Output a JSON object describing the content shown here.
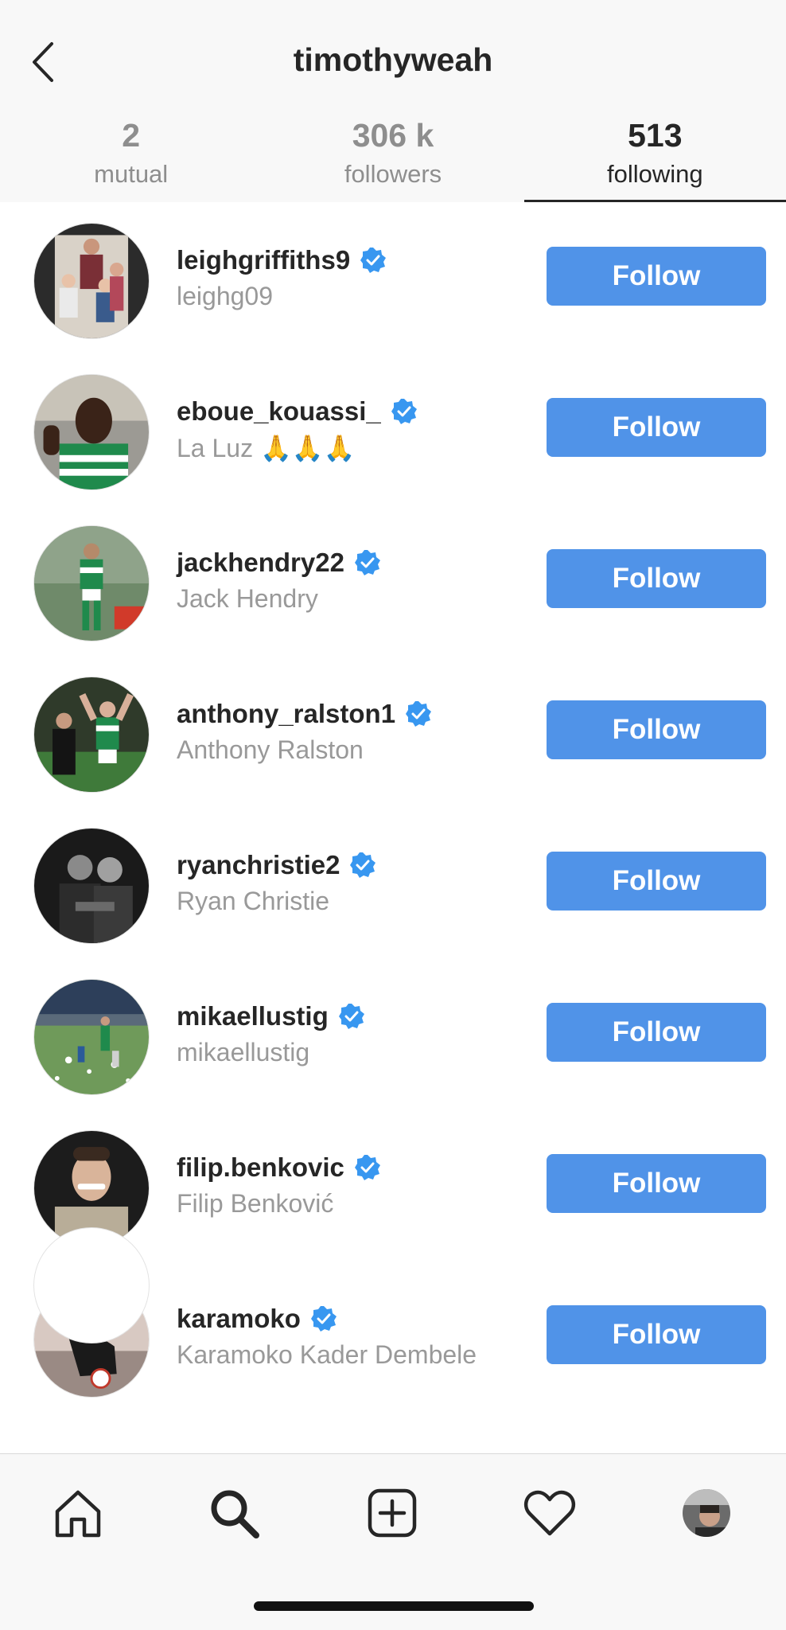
{
  "header": {
    "title": "timothyweah",
    "tabs": [
      {
        "count": "2",
        "label": "mutual",
        "active": false
      },
      {
        "count": "306 k",
        "label": "followers",
        "active": false
      },
      {
        "count": "513",
        "label": "following",
        "active": true
      }
    ]
  },
  "accounts": [
    {
      "username": "leighgriffiths9",
      "fullname": "leighg09",
      "button": "Follow"
    },
    {
      "username": "eboue_kouassi_",
      "fullname": "La Luz 🙏🙏🙏",
      "button": "Follow"
    },
    {
      "username": "jackhendry22",
      "fullname": "Jack Hendry",
      "button": "Follow"
    },
    {
      "username": "anthony_ralston1",
      "fullname": "Anthony Ralston",
      "button": "Follow"
    },
    {
      "username": "ryanchristie2",
      "fullname": "Ryan Christie",
      "button": "Follow"
    },
    {
      "username": "mikaellustig",
      "fullname": "mikaellustig",
      "button": "Follow"
    },
    {
      "username": "filip.benkovic",
      "fullname": "Filip Benković",
      "button": "Follow"
    },
    {
      "username": "karamoko",
      "fullname": "Karamoko Kader Dembele",
      "button": "Follow"
    }
  ],
  "tabbar": {
    "icons": [
      "home-icon",
      "search-icon",
      "add-post-icon",
      "heart-icon",
      "profile-avatar"
    ]
  },
  "colors": {
    "accent": "#5093e8",
    "verified": "#3897f0",
    "muted_text": "#999999",
    "header_bg": "#f8f8f8"
  }
}
